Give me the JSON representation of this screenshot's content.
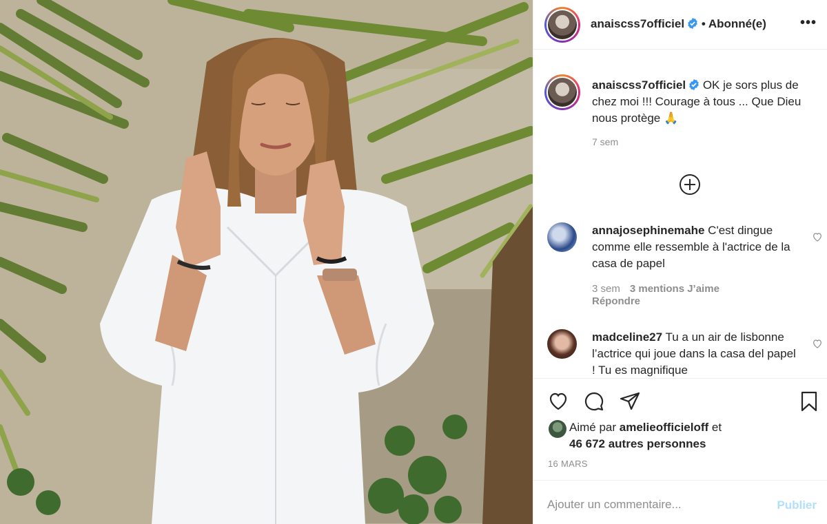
{
  "post": {
    "author": "anaiscss7officiel",
    "follow_state": "• Abonné(e)",
    "more_label": "•••"
  },
  "caption": {
    "author": "anaiscss7officiel",
    "text": "OK je sors plus de chez moi !!! Courage à tous ... Que Dieu nous protège 🙏",
    "time": "7 sem"
  },
  "comments": [
    {
      "username": "annajosephinemahe",
      "text": "C'est dingue comme elle ressemble à l'actrice de la casa de papel",
      "time": "3 sem",
      "likes": "3 mentions J’aime",
      "reply": "Répondre"
    },
    {
      "username": "madceline27",
      "text": "Tu a un air de lisbonne l’actrice qui joue dans la casa del papel ! Tu es magnifique"
    }
  ],
  "likes": {
    "prefix": "Aimé par",
    "liker": "amelieofficieloff",
    "suffix": "et",
    "others": "46 672 autres personnes"
  },
  "date": "16 MARS",
  "add_comment": {
    "placeholder": "Ajouter un commentaire...",
    "publish": "Publier"
  },
  "colors": {
    "verified": "#3897f0",
    "publish_disabled": "#b2dffc",
    "meta_gray": "#8e8e8e"
  },
  "icons": [
    "verified-badge-icon",
    "more-options-icon",
    "load-more-comments-icon",
    "heart-icon",
    "comment-icon",
    "share-icon",
    "bookmark-icon"
  ]
}
